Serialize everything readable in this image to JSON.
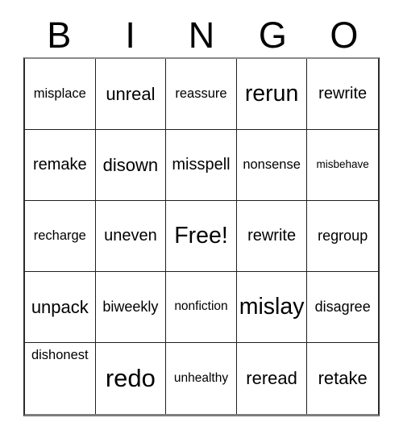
{
  "card": {
    "title": "BINGO",
    "header_letters": [
      "B",
      "I",
      "N",
      "G",
      "O"
    ],
    "free_space_label": "Free!",
    "colors": {
      "text": "#000000",
      "background": "#ffffff",
      "grid_line": "#1f1f1f",
      "outer_border": "#8a8a8a"
    },
    "grid": {
      "columns": 5,
      "rows": 5,
      "cells": [
        [
          {
            "label": "misplace",
            "size": "fs-16"
          },
          {
            "label": "unreal",
            "size": "fs-22"
          },
          {
            "label": "reassure",
            "size": "fs-16"
          },
          {
            "label": "rerun",
            "size": "fs-28"
          },
          {
            "label": "rewrite",
            "size": "fs-20"
          }
        ],
        [
          {
            "label": "remake",
            "size": "fs-20"
          },
          {
            "label": "disown",
            "size": "fs-22"
          },
          {
            "label": "misspell",
            "size": "fs-20"
          },
          {
            "label": "nonsense",
            "size": "fs-16"
          },
          {
            "label": "misbehave",
            "size": "fs-13"
          }
        ],
        [
          {
            "label": "recharge",
            "size": "fs-16"
          },
          {
            "label": "uneven",
            "size": "fs-20"
          },
          {
            "label": "Free!",
            "size": "fs-28"
          },
          {
            "label": "rewrite",
            "size": "fs-20"
          },
          {
            "label": "regroup",
            "size": "fs-18"
          }
        ],
        [
          {
            "label": "unpack",
            "size": "fs-22"
          },
          {
            "label": "biweekly",
            "size": "fs-18"
          },
          {
            "label": "nonfiction",
            "size": "fs-15"
          },
          {
            "label": "mislay",
            "size": "fs-28"
          },
          {
            "label": "disagree",
            "size": "fs-18"
          }
        ],
        [
          {
            "label": "dishonest",
            "size": "fs-16"
          },
          {
            "label": "redo",
            "size": "fs-30"
          },
          {
            "label": "unhealthy",
            "size": "fs-15"
          },
          {
            "label": "reread",
            "size": "fs-22"
          },
          {
            "label": "retake",
            "size": "fs-22"
          }
        ]
      ]
    }
  }
}
